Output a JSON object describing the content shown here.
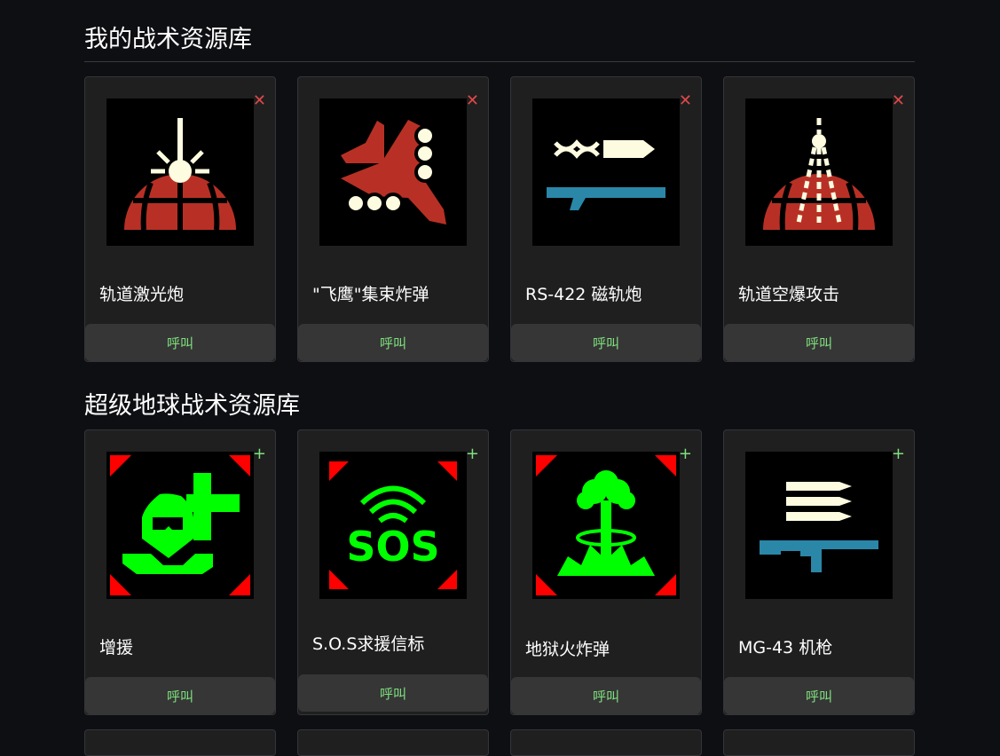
{
  "sections": [
    {
      "title": "我的战术资源库",
      "items": [
        {
          "name": "轨道激光炮",
          "action": "呼叫",
          "corner": "✕",
          "icon": "orbital-laser-icon"
        },
        {
          "name": "\"飞鹰\"集束炸弹",
          "action": "呼叫",
          "corner": "✕",
          "icon": "eagle-cluster-bomb-icon"
        },
        {
          "name": "RS-422 磁轨炮",
          "action": "呼叫",
          "corner": "✕",
          "icon": "railgun-icon"
        },
        {
          "name": "轨道空爆攻击",
          "action": "呼叫",
          "corner": "✕",
          "icon": "orbital-airburst-icon"
        }
      ]
    },
    {
      "title": "超级地球战术资源库",
      "items": [
        {
          "name": "增援",
          "action": "呼叫",
          "corner": "+",
          "icon": "reinforce-icon"
        },
        {
          "name": "S.O.S求援信标",
          "action": "呼叫",
          "corner": "+",
          "icon": "sos-beacon-icon"
        },
        {
          "name": "地狱火炸弹",
          "action": "呼叫",
          "corner": "+",
          "icon": "hellbomb-icon"
        },
        {
          "name": "MG-43 机枪",
          "action": "呼叫",
          "corner": "+",
          "icon": "machine-gun-icon"
        }
      ]
    }
  ],
  "colors": {
    "red": "#b83025",
    "cream": "#fdfbe0",
    "green": "#00ff00",
    "blue": "#2a87a8",
    "corner_red": "#ff0000"
  }
}
